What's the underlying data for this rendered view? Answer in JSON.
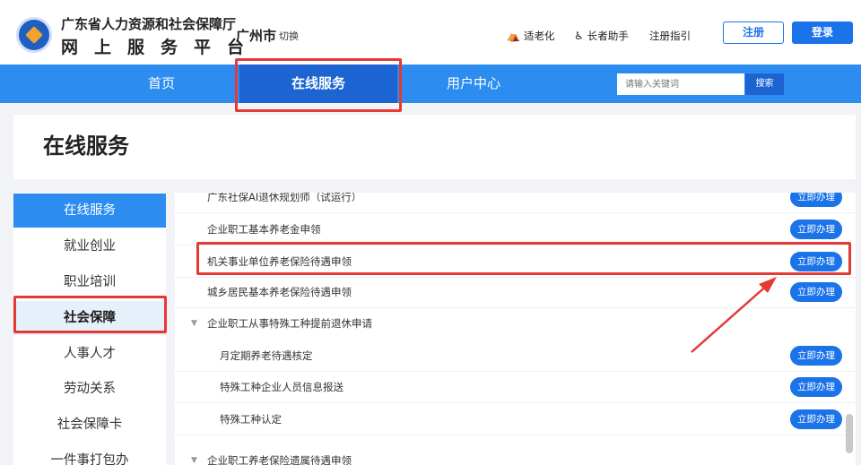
{
  "header": {
    "brand_top": "广东省人力资源和社会保障厅",
    "brand_bottom": "网上服务平台",
    "city": "广州市",
    "switch_label": "切换",
    "links": {
      "elder": "适老化",
      "assist": "长者助手",
      "guide": "注册指引"
    },
    "register_label": "注册",
    "login_label": "登录",
    "icons": {
      "elder": "elder-mode-icon",
      "assist": "wheelchair-icon"
    }
  },
  "nav": {
    "home": "首页",
    "online": "在线服务",
    "user": "用户中心",
    "search_placeholder": "请输入关键词",
    "search_button": "搜索"
  },
  "page_title": "在线服务",
  "sidebar": {
    "items": [
      {
        "label": "在线服务"
      },
      {
        "label": "就业创业"
      },
      {
        "label": "职业培训"
      },
      {
        "label": "社会保障"
      },
      {
        "label": "人事人才"
      },
      {
        "label": "劳动关系"
      },
      {
        "label": "社会保障卡"
      },
      {
        "label": "一件事打包办"
      }
    ]
  },
  "services": {
    "rows": [
      {
        "label": "广东社保AI退休规划师（试运行）",
        "button": "立即办理"
      },
      {
        "label": "企业职工基本养老金申领",
        "button": "立即办理"
      },
      {
        "label": "机关事业单位养老保险待遇申领",
        "button": "立即办理"
      },
      {
        "label": "城乡居民基本养老保险待遇申领",
        "button": "立即办理"
      }
    ],
    "group1": {
      "label": "企业职工从事特殊工种提前退休申请",
      "rows": [
        {
          "label": "月定期养老待遇核定",
          "button": "立即办理"
        },
        {
          "label": "特殊工种企业人员信息报送",
          "button": "立即办理"
        },
        {
          "label": "特殊工种认定",
          "button": "立即办理"
        }
      ]
    },
    "group2": {
      "label": "企业职工养老保险遗属待遇申领"
    }
  },
  "colors": {
    "primary": "#2d8cf0",
    "primary_dark": "#1b64d2",
    "button": "#1a73e8",
    "highlight": "#e53935"
  }
}
